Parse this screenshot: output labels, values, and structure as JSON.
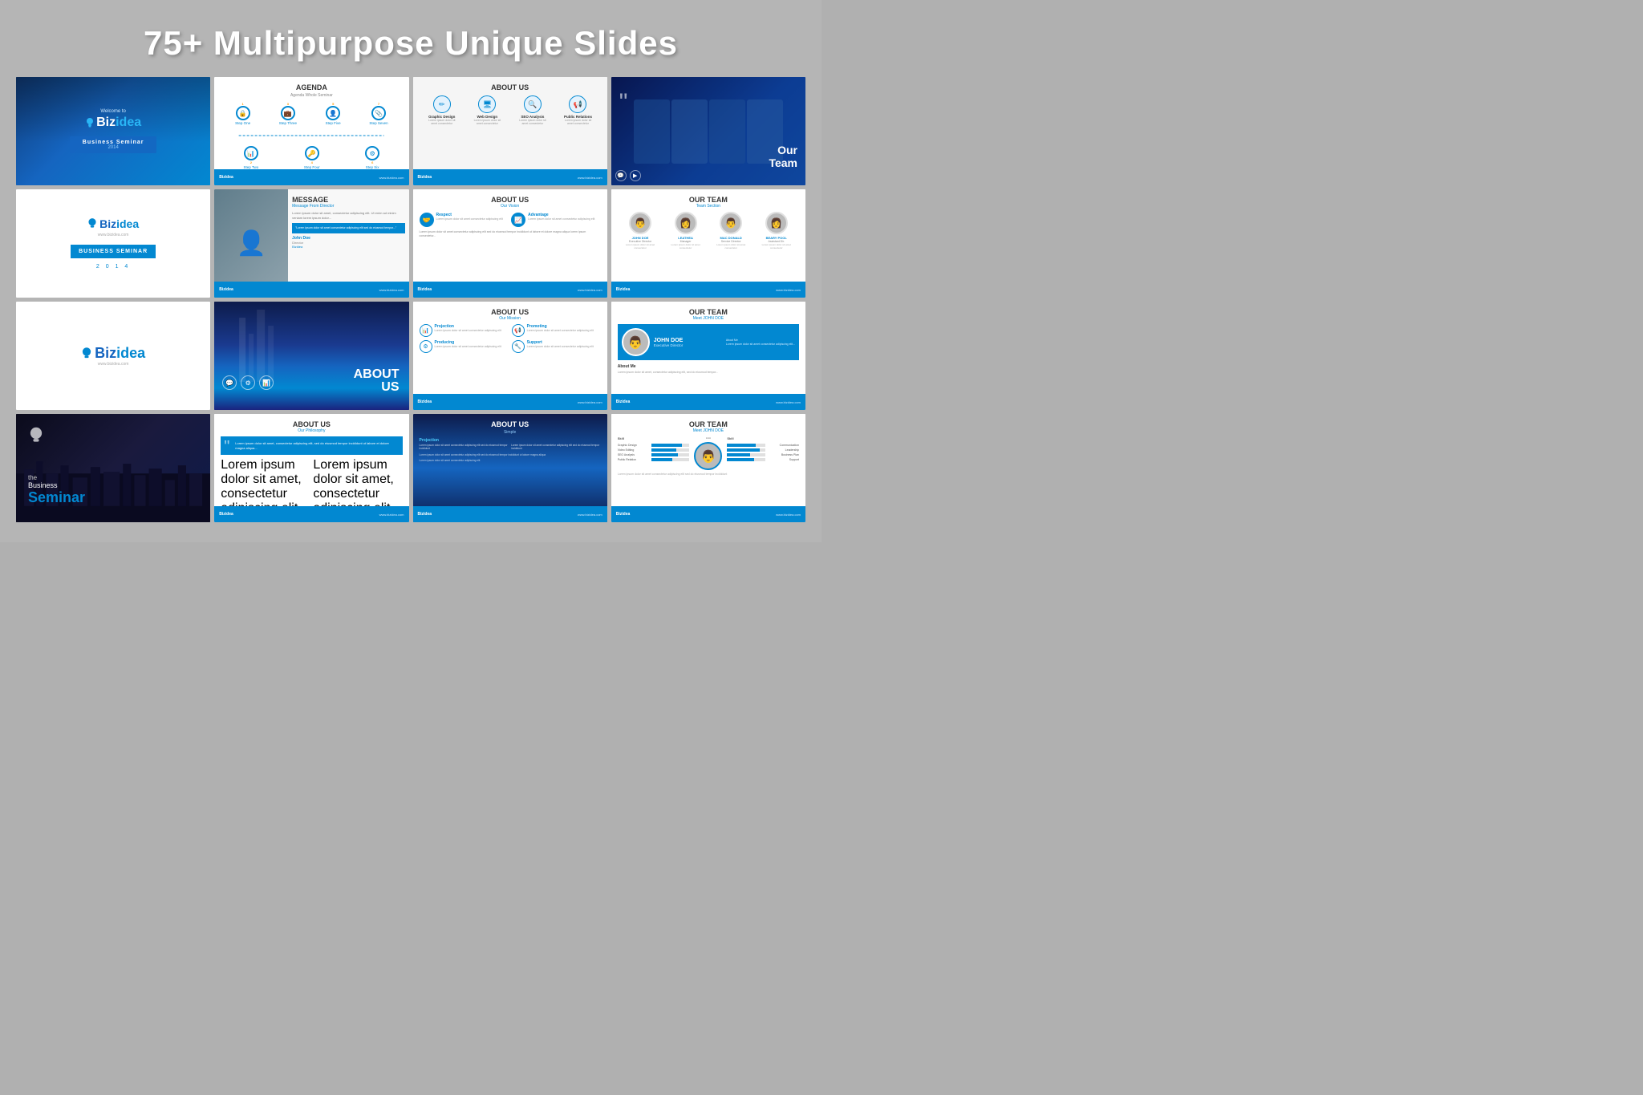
{
  "page": {
    "title": "75+ Multipurpose Unique Slides",
    "background_color": "#b5b5b5"
  },
  "slides": [
    {
      "id": 1,
      "type": "welcome",
      "welcome_text": "Welcome to",
      "brand": "BizIdea",
      "tag": "Business Seminar",
      "year": "2014"
    },
    {
      "id": 2,
      "type": "agenda",
      "title": "AGENDA",
      "subtitle": "Agenda Whole Seminar",
      "steps": [
        {
          "num": "1",
          "label": "Step One"
        },
        {
          "num": "2",
          "label": "Step Two"
        },
        {
          "num": "3",
          "label": "Step Three"
        },
        {
          "num": "4",
          "label": "Step Four"
        },
        {
          "num": "5",
          "label": "Step Five"
        },
        {
          "num": "6",
          "label": "Step Six"
        },
        {
          "num": "7",
          "label": "Step Seven"
        }
      ]
    },
    {
      "id": 3,
      "type": "about_us_icons",
      "title": "ABOUT US",
      "services": [
        {
          "icon": "✏",
          "label": "Graphic Design"
        },
        {
          "icon": "🖥",
          "label": "Web Design"
        },
        {
          "icon": "🔍",
          "label": "SEO Analysis"
        },
        {
          "icon": "📢",
          "label": "Public Relations"
        }
      ]
    },
    {
      "id": 4,
      "type": "our_team_dark",
      "title": "Our\nTeam",
      "quote_mark": "“"
    },
    {
      "id": 5,
      "type": "biz_seminar",
      "brand": "BizIdea",
      "website": "www.bizidea.com",
      "title": "BUSINESS SEMINAR",
      "year": "2 0 1 4"
    },
    {
      "id": 6,
      "type": "message",
      "title": "MESSAGE",
      "subtitle": "Message From Director",
      "body": "Lorem ipsum dolor sit amet, consectetur adipiscing elit...",
      "person_name": "John Doe",
      "person_title": "Director",
      "company": "Bizidea"
    },
    {
      "id": 7,
      "type": "about_us_vision",
      "title": "ABOUT US",
      "subtitle": "Our Vision",
      "items": [
        {
          "icon": "🤝",
          "title": "Respect",
          "text": "Lorem ipsum dolor sit amet consectetur adipiscing"
        },
        {
          "icon": "📈",
          "title": "Advantage",
          "text": "Lorem ipsum dolor sit amet consectetur adipiscing"
        },
        {
          "icon": "",
          "title": "",
          "text": "Lorem ipsum dolor sit amet consectetur adipiscing"
        },
        {
          "icon": "",
          "title": "",
          "text": "Lorem ipsum dolor sit amet consectetur adipiscing"
        }
      ]
    },
    {
      "id": 8,
      "type": "our_team_profiles",
      "title": "OUR TEAM",
      "subtitle": "Team Section",
      "members": [
        {
          "name": "JOHN DOE",
          "role": "Executive Director"
        },
        {
          "name": "LEATHEA",
          "role": "Manager"
        },
        {
          "name": "MAC DONALD",
          "role": "Service Director"
        },
        {
          "name": "BEARY POOL",
          "role": "Assistant Dir."
        }
      ]
    },
    {
      "id": 9,
      "type": "biz_logo_only",
      "brand": "BizIdea",
      "website": "www.bizidea.com"
    },
    {
      "id": 10,
      "type": "about_us_dark_tech",
      "title": "ABOUT",
      "title2": "US"
    },
    {
      "id": 11,
      "type": "about_us_mission",
      "title": "ABOUT US",
      "subtitle": "Our Mission",
      "items": [
        {
          "icon": "📊",
          "title": "Projection",
          "text": "Lorem ipsum dolor sit amet consectetur"
        },
        {
          "icon": "📢",
          "title": "Promoting",
          "text": "Lorem ipsum dolor sit amet consectetur"
        },
        {
          "icon": "⚙",
          "title": "Producing",
          "text": "Lorem ipsum dolor sit amet consectetur"
        },
        {
          "icon": "🔧",
          "title": "Support",
          "text": "Lorem ipsum dolor sit amet consectetur"
        }
      ]
    },
    {
      "id": 12,
      "type": "our_team_john",
      "title": "OUR TEAM",
      "subtitle": "Meet JOHN DOE",
      "person_name": "JOHN DOE",
      "person_role": "Executive Director",
      "about_title": "About Me",
      "about_text": "Lorem ipsum dolor sit amet, consectetur adipiscing elit, sed do eiusmod tempor..."
    },
    {
      "id": 13,
      "type": "biz_seminar_dark",
      "the_text": "the",
      "business_text": "Business",
      "seminar_text": "Seminar"
    },
    {
      "id": 14,
      "type": "about_us_philosophy",
      "title": "ABOUT US",
      "subtitle": "Our Philosophy",
      "quote": "Lorem ipsum dolor sit amet, consectetur adipiscing elit, sed do eiusmod tempor incididunt ut labore et dolore magna aliqua...",
      "col1_text": "Lorem ipsum dolor sit amet, consectetur adipiscing elit, sed do eiusmod tempor incididunt...",
      "col2_text": "Lorem ipsum dolor sit amet, consectetur adipiscing elit, sed do eiusmod tempor incididunt..."
    },
    {
      "id": 15,
      "type": "about_us_simple",
      "title": "ABOUT US",
      "section_title": "Simple",
      "text1": "Lorem ipsum dolor sit amet consectetur adipiscing elit sed do eiusmod tempor",
      "text2": "Lorem ipsum dolor sit amet consectetur adipiscing elit sed do eiusmod tempor"
    },
    {
      "id": 16,
      "type": "our_team_skills",
      "title": "OUR TEAM",
      "subtitle": "Meet JOHN DOE",
      "skills_left": [
        {
          "name": "Graphic Design",
          "percent": 80
        },
        {
          "name": "Video Editing",
          "percent": 65
        },
        {
          "name": "SEO Analysis",
          "percent": 70
        },
        {
          "name": "Public Relation",
          "percent": 55
        }
      ],
      "skills_right": [
        {
          "name": "Communication",
          "percent": 75
        },
        {
          "name": "Leadership",
          "percent": 85
        },
        {
          "name": "Business Plan",
          "percent": 60
        },
        {
          "name": "Support",
          "percent": 70
        }
      ]
    }
  ],
  "footer": {
    "logo": "Biz",
    "logo_accent": "idea",
    "contact": "www.bizidea.com"
  }
}
